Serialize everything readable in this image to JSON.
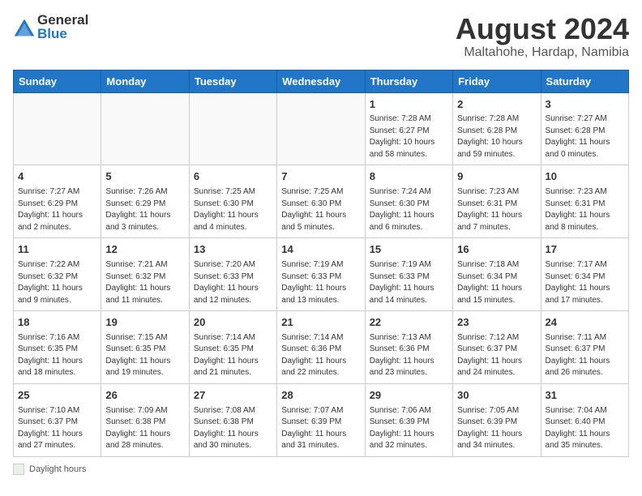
{
  "header": {
    "logo_general": "General",
    "logo_blue": "Blue",
    "title": "August 2024",
    "subtitle": "Maltahohe, Hardap, Namibia"
  },
  "days_of_week": [
    "Sunday",
    "Monday",
    "Tuesday",
    "Wednesday",
    "Thursday",
    "Friday",
    "Saturday"
  ],
  "weeks": [
    [
      {
        "day": "",
        "info": ""
      },
      {
        "day": "",
        "info": ""
      },
      {
        "day": "",
        "info": ""
      },
      {
        "day": "",
        "info": ""
      },
      {
        "day": "1",
        "info": "Sunrise: 7:28 AM\nSunset: 6:27 PM\nDaylight: 10 hours\nand 58 minutes."
      },
      {
        "day": "2",
        "info": "Sunrise: 7:28 AM\nSunset: 6:28 PM\nDaylight: 10 hours\nand 59 minutes."
      },
      {
        "day": "3",
        "info": "Sunrise: 7:27 AM\nSunset: 6:28 PM\nDaylight: 11 hours\nand 0 minutes."
      }
    ],
    [
      {
        "day": "4",
        "info": "Sunrise: 7:27 AM\nSunset: 6:29 PM\nDaylight: 11 hours\nand 2 minutes."
      },
      {
        "day": "5",
        "info": "Sunrise: 7:26 AM\nSunset: 6:29 PM\nDaylight: 11 hours\nand 3 minutes."
      },
      {
        "day": "6",
        "info": "Sunrise: 7:25 AM\nSunset: 6:30 PM\nDaylight: 11 hours\nand 4 minutes."
      },
      {
        "day": "7",
        "info": "Sunrise: 7:25 AM\nSunset: 6:30 PM\nDaylight: 11 hours\nand 5 minutes."
      },
      {
        "day": "8",
        "info": "Sunrise: 7:24 AM\nSunset: 6:30 PM\nDaylight: 11 hours\nand 6 minutes."
      },
      {
        "day": "9",
        "info": "Sunrise: 7:23 AM\nSunset: 6:31 PM\nDaylight: 11 hours\nand 7 minutes."
      },
      {
        "day": "10",
        "info": "Sunrise: 7:23 AM\nSunset: 6:31 PM\nDaylight: 11 hours\nand 8 minutes."
      }
    ],
    [
      {
        "day": "11",
        "info": "Sunrise: 7:22 AM\nSunset: 6:32 PM\nDaylight: 11 hours\nand 9 minutes."
      },
      {
        "day": "12",
        "info": "Sunrise: 7:21 AM\nSunset: 6:32 PM\nDaylight: 11 hours\nand 11 minutes."
      },
      {
        "day": "13",
        "info": "Sunrise: 7:20 AM\nSunset: 6:33 PM\nDaylight: 11 hours\nand 12 minutes."
      },
      {
        "day": "14",
        "info": "Sunrise: 7:19 AM\nSunset: 6:33 PM\nDaylight: 11 hours\nand 13 minutes."
      },
      {
        "day": "15",
        "info": "Sunrise: 7:19 AM\nSunset: 6:33 PM\nDaylight: 11 hours\nand 14 minutes."
      },
      {
        "day": "16",
        "info": "Sunrise: 7:18 AM\nSunset: 6:34 PM\nDaylight: 11 hours\nand 15 minutes."
      },
      {
        "day": "17",
        "info": "Sunrise: 7:17 AM\nSunset: 6:34 PM\nDaylight: 11 hours\nand 17 minutes."
      }
    ],
    [
      {
        "day": "18",
        "info": "Sunrise: 7:16 AM\nSunset: 6:35 PM\nDaylight: 11 hours\nand 18 minutes."
      },
      {
        "day": "19",
        "info": "Sunrise: 7:15 AM\nSunset: 6:35 PM\nDaylight: 11 hours\nand 19 minutes."
      },
      {
        "day": "20",
        "info": "Sunrise: 7:14 AM\nSunset: 6:35 PM\nDaylight: 11 hours\nand 21 minutes."
      },
      {
        "day": "21",
        "info": "Sunrise: 7:14 AM\nSunset: 6:36 PM\nDaylight: 11 hours\nand 22 minutes."
      },
      {
        "day": "22",
        "info": "Sunrise: 7:13 AM\nSunset: 6:36 PM\nDaylight: 11 hours\nand 23 minutes."
      },
      {
        "day": "23",
        "info": "Sunrise: 7:12 AM\nSunset: 6:37 PM\nDaylight: 11 hours\nand 24 minutes."
      },
      {
        "day": "24",
        "info": "Sunrise: 7:11 AM\nSunset: 6:37 PM\nDaylight: 11 hours\nand 26 minutes."
      }
    ],
    [
      {
        "day": "25",
        "info": "Sunrise: 7:10 AM\nSunset: 6:37 PM\nDaylight: 11 hours\nand 27 minutes."
      },
      {
        "day": "26",
        "info": "Sunrise: 7:09 AM\nSunset: 6:38 PM\nDaylight: 11 hours\nand 28 minutes."
      },
      {
        "day": "27",
        "info": "Sunrise: 7:08 AM\nSunset: 6:38 PM\nDaylight: 11 hours\nand 30 minutes."
      },
      {
        "day": "28",
        "info": "Sunrise: 7:07 AM\nSunset: 6:39 PM\nDaylight: 11 hours\nand 31 minutes."
      },
      {
        "day": "29",
        "info": "Sunrise: 7:06 AM\nSunset: 6:39 PM\nDaylight: 11 hours\nand 32 minutes."
      },
      {
        "day": "30",
        "info": "Sunrise: 7:05 AM\nSunset: 6:39 PM\nDaylight: 11 hours\nand 34 minutes."
      },
      {
        "day": "31",
        "info": "Sunrise: 7:04 AM\nSunset: 6:40 PM\nDaylight: 11 hours\nand 35 minutes."
      }
    ]
  ],
  "footer": {
    "daylight_label": "Daylight hours"
  }
}
